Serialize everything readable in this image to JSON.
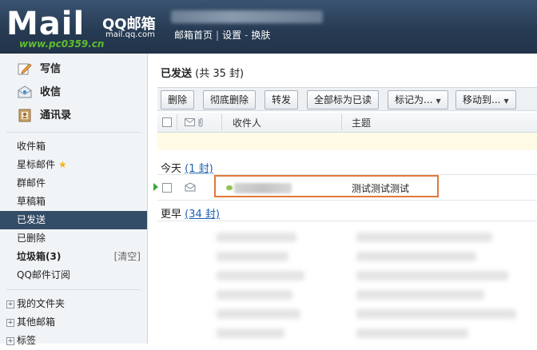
{
  "header": {
    "logo_text": "Mail",
    "logo_qq": "QQ邮箱",
    "logo_domain": "mail.qq.com",
    "watermark": "www.pc0359.cn",
    "nav": [
      "邮箱首页",
      "设置",
      "换肤"
    ]
  },
  "sidebar": {
    "primary": [
      {
        "label": "写信",
        "icon": "pencil-icon"
      },
      {
        "label": "收信",
        "icon": "inbox-icon"
      },
      {
        "label": "通讯录",
        "icon": "contacts-icon"
      }
    ],
    "folders": [
      {
        "label": "收件箱"
      },
      {
        "label": "星标邮件"
      },
      {
        "label": "群邮件"
      },
      {
        "label": "草稿箱"
      },
      {
        "label": "已发送",
        "active": true
      },
      {
        "label": "已删除"
      },
      {
        "label": "垃圾箱(3)",
        "extra": "[清空]"
      },
      {
        "label": "QQ邮件订阅"
      }
    ],
    "groups": [
      "我的文件夹",
      "其他邮箱",
      "标签"
    ]
  },
  "main": {
    "title": "已发送",
    "count_text": "(共 35 封)",
    "toolbar": {
      "delete": "删除",
      "delete_forever": "彻底删除",
      "forward": "转发",
      "mark_all_read": "全部标为已读",
      "mark_as": "标记为...",
      "move_to": "移动到..."
    },
    "columns": {
      "recipient": "收件人",
      "subject": "主题"
    },
    "today": {
      "label": "今天",
      "count": "(1 封)"
    },
    "earlier": {
      "label": "更早",
      "count": "(34 封)"
    },
    "mail_row": {
      "subject": "测试测试测试"
    }
  },
  "colors": {
    "topbar": "#263a52",
    "active_folder": "#344d66",
    "highlight": "#e0793a"
  }
}
